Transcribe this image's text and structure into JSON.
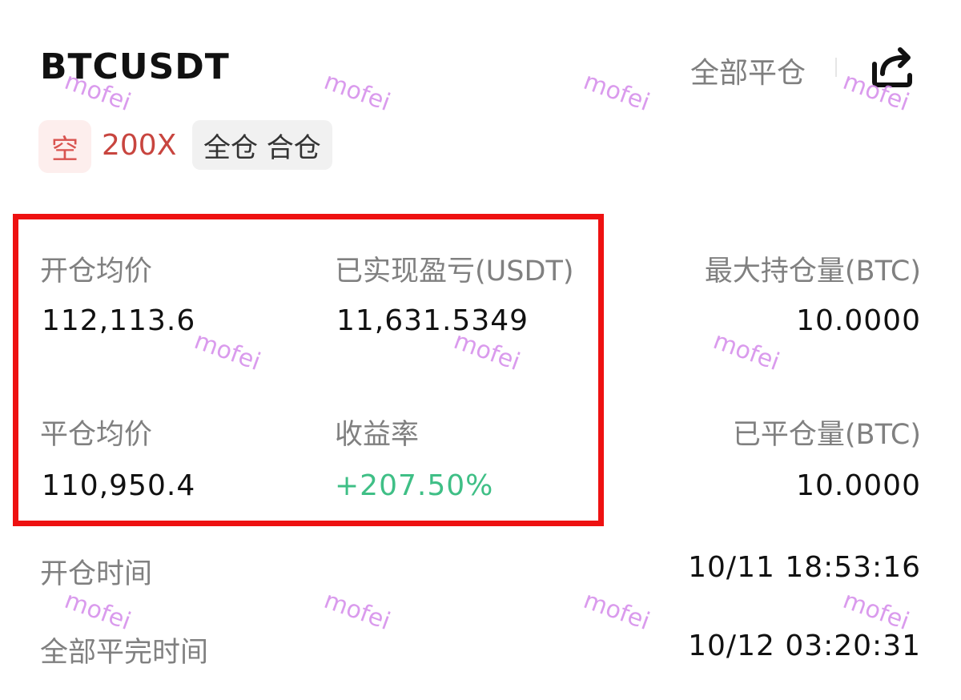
{
  "header": {
    "symbol": "BTCUSDT",
    "close_all_label": "全部平仓"
  },
  "tags": {
    "side": "空",
    "leverage": "200X",
    "mode": "全仓 合仓"
  },
  "stats": {
    "avg_open_price_label": "开仓均价",
    "avg_open_price": "112,113.6",
    "realized_pnl_label": "已实现盈亏(USDT)",
    "realized_pnl": "11,631.5349",
    "max_position_label": "最大持仓量(BTC)",
    "max_position": "10.0000",
    "avg_close_price_label": "平仓均价",
    "avg_close_price": "110,950.4",
    "roi_label": "收益率",
    "roi": "+207.50%",
    "closed_qty_label": "已平仓量(BTC)",
    "closed_qty": "10.0000"
  },
  "times": {
    "open_time_label": "开仓时间",
    "open_time": "10/11 18:53:16",
    "close_time_label": "全部平完时间",
    "close_time": "10/12 03:20:31"
  },
  "watermark": "mofei",
  "colors": {
    "short_red": "#d9534f",
    "profit_green": "#3fbf86",
    "highlight_border": "#ee1111",
    "watermark": "#d691ec"
  }
}
